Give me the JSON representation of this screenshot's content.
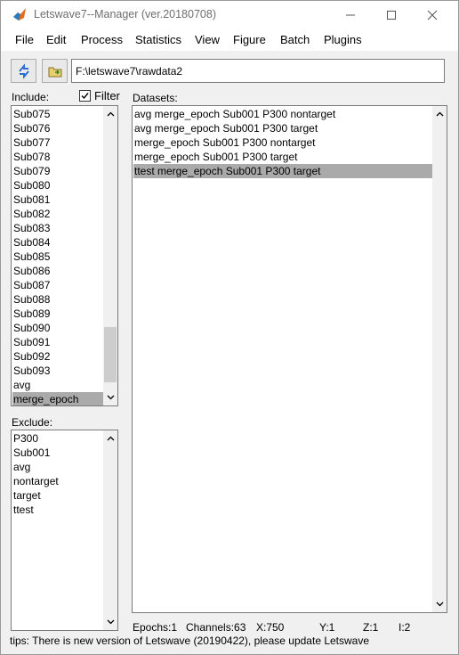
{
  "window": {
    "title": "Letswave7--Manager (ver.20180708)",
    "icon": "matlab-icon"
  },
  "menu": [
    "File",
    "Edit",
    "Process",
    "Statistics",
    "View",
    "Figure",
    "Batch",
    "Plugins"
  ],
  "toolbar": {
    "refresh_icon": "refresh-arrows-icon",
    "folder_icon": "folder-icon",
    "path": "F:\\letswave7\\rawdata2"
  },
  "include": {
    "label": "Include:",
    "filter_label": "Filter",
    "filter_checked": true,
    "items": [
      "Sub075",
      "Sub076",
      "Sub077",
      "Sub078",
      "Sub079",
      "Sub080",
      "Sub081",
      "Sub082",
      "Sub083",
      "Sub084",
      "Sub085",
      "Sub086",
      "Sub087",
      "Sub088",
      "Sub089",
      "Sub090",
      "Sub091",
      "Sub092",
      "Sub093",
      "avg",
      "merge_epoch"
    ],
    "selected": "merge_epoch"
  },
  "exclude": {
    "label": "Exclude:",
    "items": [
      "P300",
      "Sub001",
      "avg",
      "nontarget",
      "target",
      "ttest"
    ]
  },
  "datasets": {
    "label": "Datasets:",
    "items": [
      "avg merge_epoch Sub001 P300 nontarget",
      "avg merge_epoch Sub001 P300 target",
      "merge_epoch Sub001 P300 nontarget",
      "merge_epoch Sub001 P300 target",
      "ttest merge_epoch Sub001 P300 target"
    ],
    "selected": "ttest merge_epoch Sub001 P300 target"
  },
  "status": {
    "epochs": "Epochs:1",
    "channels": "Channels:63",
    "x": "X:750",
    "y": "Y:1",
    "z": "Z:1",
    "i": "I:2"
  },
  "tips": "tips: There is new version of Letswave (20190422), please update Letswave",
  "colors": {
    "selection": "#aaaaaa",
    "background": "#f0f0f0"
  }
}
